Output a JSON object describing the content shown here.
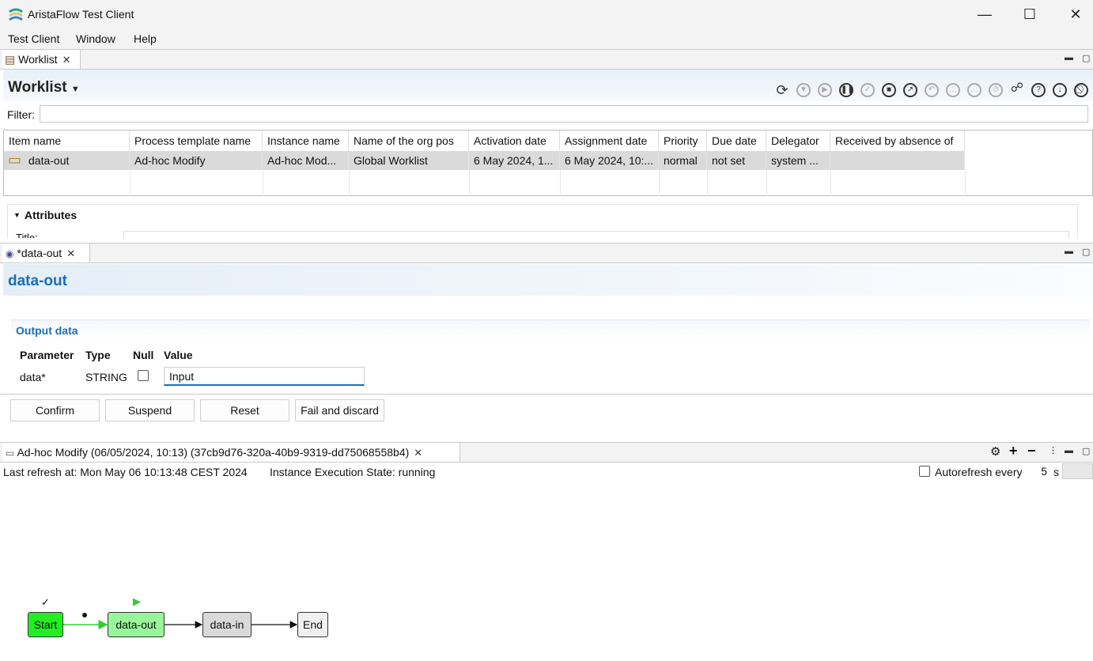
{
  "window": {
    "title": "AristaFlow Test Client",
    "minimize": "—",
    "maximize": "☐",
    "close": "✕"
  },
  "menu": [
    "Test Client",
    "Window",
    "Help"
  ],
  "worklist_view": {
    "tab_label": "Worklist",
    "header_title": "Worklist",
    "filter_label": "Filter:",
    "filter_value": "",
    "columns": [
      "Item name",
      "Process template name",
      "Instance name",
      "Name of the org pos",
      "Activation date",
      "Assignment date",
      "Priority",
      "Due date",
      "Delegator",
      "Received by absence of"
    ],
    "rows": [
      [
        "data-out",
        "Ad-hoc Modify",
        "Ad-hoc Mod...",
        "Global Worklist",
        "6 May 2024, 1...",
        "6 May 2024, 10:...",
        "normal",
        "not set",
        "system ...",
        ""
      ]
    ],
    "attributes_label": "Attributes",
    "attributes_partial_label": "Title:"
  },
  "form_view": {
    "tab_label": "*data-out",
    "title": "data-out",
    "section_title": "Output data",
    "columns": [
      "Parameter",
      "Type",
      "Null",
      "Value"
    ],
    "param": {
      "name": "data*",
      "type": "STRING",
      "null_checked": false,
      "value": "Input"
    },
    "buttons": [
      "Confirm",
      "Suspend",
      "Reset",
      "Fail and discard"
    ]
  },
  "graph_view": {
    "tab_label": "Ad-hoc Modify (06/05/2024, 10:13) (37cb9d76-320a-40b9-9319-dd75068558b4)",
    "last_refresh": "Last refresh at: Mon May 06 10:13:48 CEST 2024",
    "execution_state": "Instance Execution State: running",
    "autorefresh_label": "Autorefresh every",
    "autorefresh_checked": false,
    "autorefresh_seconds": "5",
    "autorefresh_unit": "s",
    "nodes": [
      {
        "label": "Start",
        "state": "completed",
        "marker": "✓",
        "color": "#22ee22"
      },
      {
        "label": "data-out",
        "state": "activated",
        "marker": "▶",
        "color": "#99f599"
      },
      {
        "label": "data-in",
        "state": "not activated",
        "marker": "",
        "color": "#d9d9d9"
      },
      {
        "label": "End",
        "state": "not activated",
        "marker": "",
        "color": "#f0f0f0"
      }
    ]
  },
  "colors": {
    "accent": "#1a6fb8",
    "selected_row": "#dadada",
    "edge_active": "#33cc33"
  }
}
